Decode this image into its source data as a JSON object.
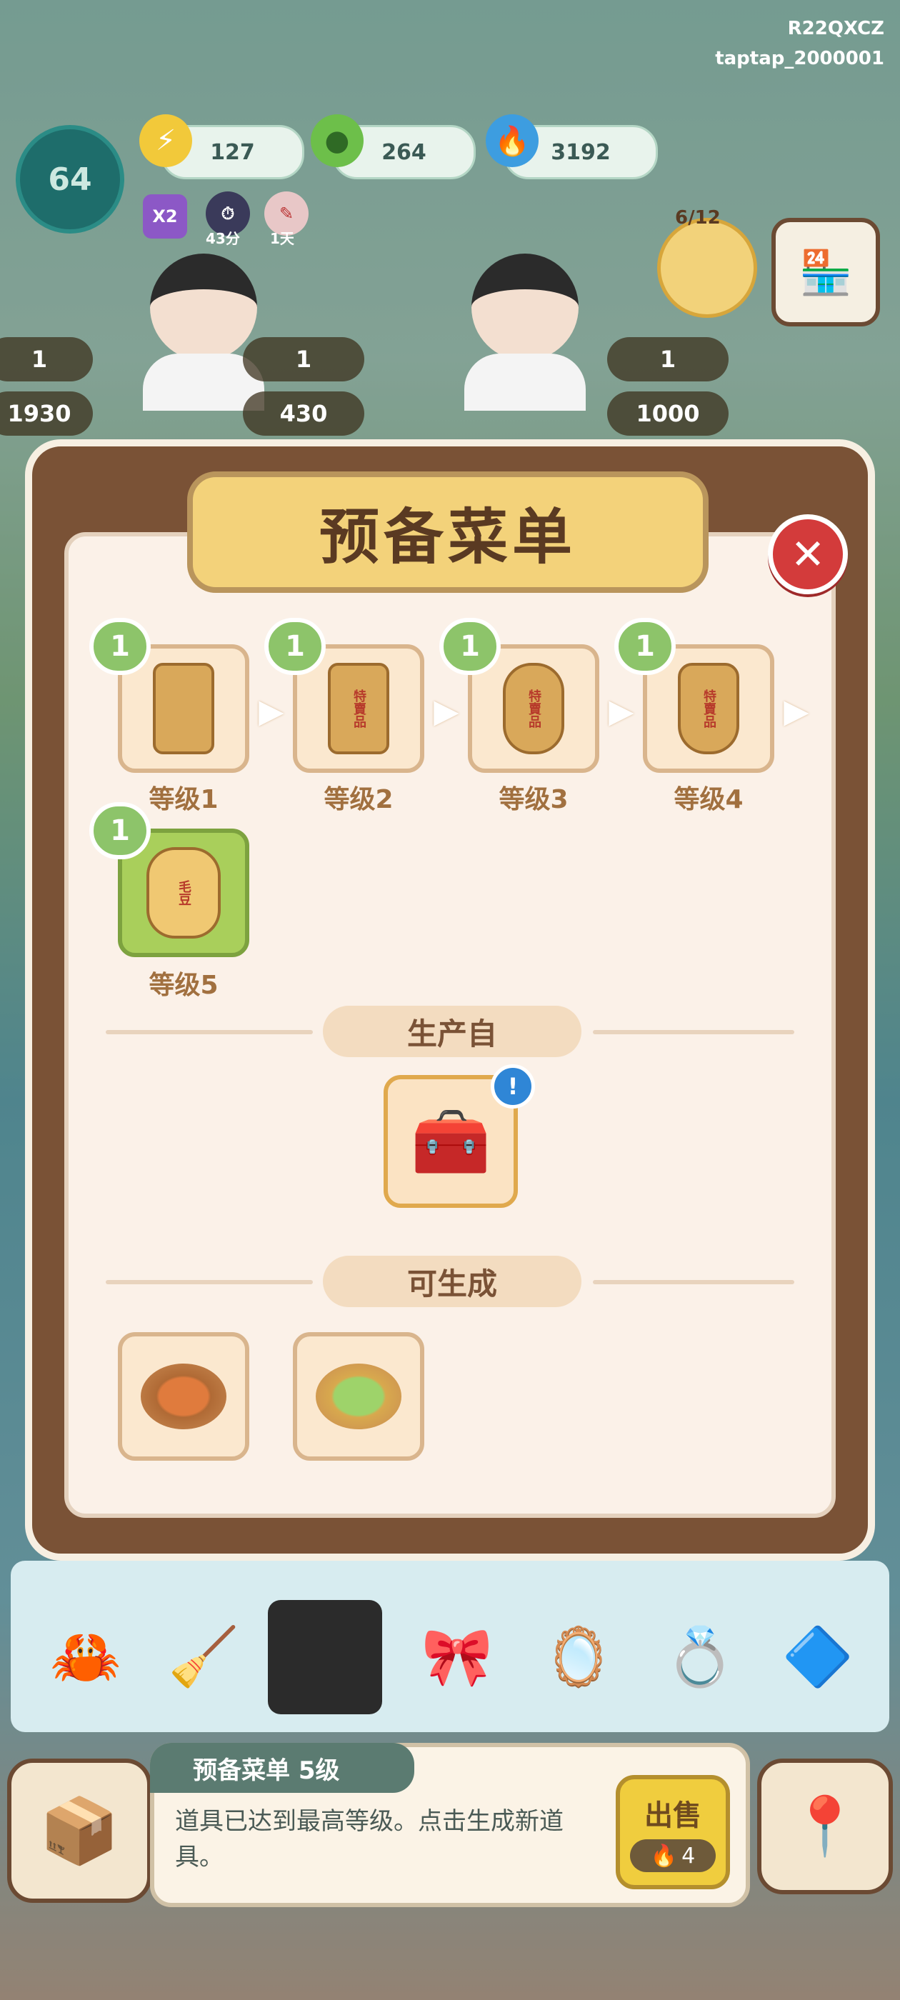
{
  "header": {
    "account_code": "R22QXCZ",
    "account_id": "taptap_2000001",
    "player_level": "64",
    "resources": [
      {
        "icon": "energy-bolt-icon",
        "value": "127"
      },
      {
        "icon": "green-coin-icon",
        "value": "264"
      },
      {
        "icon": "blue-flame-icon",
        "value": "3192"
      }
    ],
    "boosts": [
      {
        "icon": "x2-boost-icon",
        "label": "X2",
        "caption": ""
      },
      {
        "icon": "timer-boost-icon",
        "label": "",
        "caption": "43分"
      },
      {
        "icon": "calendar-boost-icon",
        "label": "",
        "caption": "1天"
      }
    ],
    "event_progress": "6/12"
  },
  "customers": [
    {
      "flower_count": "1",
      "reward": "1930"
    },
    {
      "flower_count": "1",
      "reward": "430"
    },
    {
      "flower_count": "1",
      "reward": "1000"
    }
  ],
  "modal": {
    "title": "预备菜单",
    "levels": [
      {
        "badge": "1",
        "label": "等级1",
        "item_text": ""
      },
      {
        "badge": "1",
        "label": "等级2",
        "item_text": "特賣品"
      },
      {
        "badge": "1",
        "label": "等级3",
        "item_text": "特賣品"
      },
      {
        "badge": "1",
        "label": "等级4",
        "item_text": "特賣品"
      },
      {
        "badge": "1",
        "label": "等级5",
        "item_text": "毛豆"
      }
    ],
    "produced_from_title": "生产自",
    "can_generate_title": "可生成",
    "generated_items": [
      {
        "icon": "beans-dish-icon"
      },
      {
        "icon": "vegetable-dish-icon"
      }
    ]
  },
  "bottom_bar": {
    "item_name_tag": "预备菜单 5级",
    "description": "道具已达到最高等级。点击生成新道具。",
    "sell_label": "出售",
    "sell_price": "4"
  },
  "colors": {
    "modal_frame": "#7a5236",
    "title_plaque": "#f3d27a",
    "level_badge": "#8dc46a",
    "selected_slot": "#a9cf5b",
    "close_button": "#d33b3b",
    "sell_button": "#f0cd3e"
  }
}
